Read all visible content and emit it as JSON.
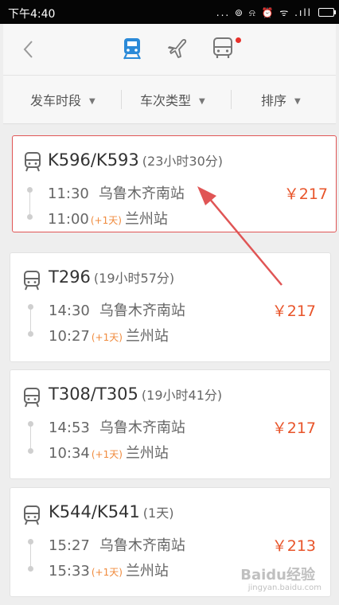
{
  "status_bar": {
    "time": "下午4:40",
    "icons": "... ⊚ ⍾ ⏰ ᯤ .ıll"
  },
  "header": {
    "modes": [
      "train",
      "plane",
      "bus"
    ],
    "active_mode": "train",
    "accent_color": "#2b8ad8",
    "badge_color": "#e7302a"
  },
  "filters": [
    {
      "label": "发车时段"
    },
    {
      "label": "车次类型"
    },
    {
      "label": "排序"
    }
  ],
  "trains": [
    {
      "code": "K596/K593",
      "duration": "(23小时30分)",
      "depart_time": "11:30",
      "depart_station": "乌鲁木齐南站",
      "arrive_time": "11:00",
      "next_day": "(+1天)",
      "arrive_station": "兰州站",
      "price": "￥217"
    },
    {
      "code": "T296",
      "duration": "(19小时57分)",
      "depart_time": "14:30",
      "depart_station": "乌鲁木齐南站",
      "arrive_time": "10:27",
      "next_day": "(+1天)",
      "arrive_station": "兰州站",
      "price": "￥217"
    },
    {
      "code": "T308/T305",
      "duration": "(19小时41分)",
      "depart_time": "14:53",
      "depart_station": "乌鲁木齐南站",
      "arrive_time": "10:34",
      "next_day": "(+1天)",
      "arrive_station": "兰州站",
      "price": "￥217"
    },
    {
      "code": "K544/K541",
      "duration": "(1天)",
      "depart_time": "15:27",
      "depart_station": "乌鲁木齐南站",
      "arrive_time": "15:33",
      "next_day": "(+1天)",
      "arrive_station": "兰州站",
      "price": "￥213"
    }
  ],
  "annotation": {
    "highlight_color": "#e05555"
  },
  "watermark": {
    "text": "Baidu经验",
    "sub": "jingyan.baidu.com"
  }
}
